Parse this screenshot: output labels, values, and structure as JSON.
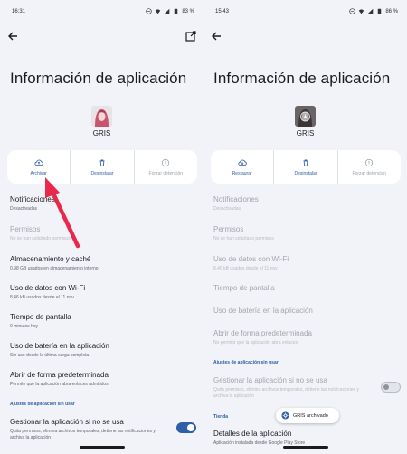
{
  "left": {
    "status": {
      "time": "16:31",
      "battery": "83 %"
    },
    "title": "Información de aplicación",
    "app_name": "GRIS",
    "actions": [
      {
        "label": "Archivar"
      },
      {
        "label": "Desinstalar"
      },
      {
        "label": "Forzar detención"
      }
    ],
    "items": {
      "notifications": {
        "title": "Notificaciones",
        "sub": "Desactivadas"
      },
      "permissions": {
        "title": "Permisos",
        "sub": "No se han solicitado permisos"
      },
      "storage": {
        "title": "Almacenamiento y caché",
        "sub": "0,98 GB usados en almacenamiento interno"
      },
      "wifi": {
        "title": "Uso de datos con Wi-Fi",
        "sub": "8,46 kB usados desde el 11 nov"
      },
      "screen_time": {
        "title": "Tiempo de pantalla",
        "sub": "0 minutos hoy"
      },
      "battery": {
        "title": "Uso de batería en la aplicación",
        "sub": "Sin uso desde la última carga completa"
      },
      "open_default": {
        "title": "Abrir de forma predeterminada",
        "sub": "Permite que la aplicación abra enlaces admitidos"
      }
    },
    "section_unused": "Ajustes de aplicación sin usar",
    "manage_unused": {
      "title": "Gestionar la aplicación si no se usa",
      "sub": "Quita permisos, elimina archivos temporales, detiene las notificaciones y archiva la aplicación",
      "enabled": true
    }
  },
  "right": {
    "status": {
      "time": "15:43",
      "battery": "86 %"
    },
    "title": "Información de aplicación",
    "app_name": "GRIS",
    "actions": [
      {
        "label": "Restaurar"
      },
      {
        "label": "Desinstalar"
      },
      {
        "label": "Forzar detención"
      }
    ],
    "items": {
      "notifications": {
        "title": "Notificaciones",
        "sub": "Desactivadas"
      },
      "permissions": {
        "title": "Permisos",
        "sub": "No se han solicitado permisos"
      },
      "wifi": {
        "title": "Uso de datos con Wi-Fi",
        "sub": "8,46 kB usados desde el 11 nov"
      },
      "screen_time": {
        "title": "Tiempo de pantalla"
      },
      "battery": {
        "title": "Uso de batería en la aplicación"
      },
      "open_default": {
        "title": "Abrir de forma predeterminada",
        "sub": "No permitir que la aplicación abra enlaces"
      }
    },
    "section_unused": "Ajustes de aplicación sin usar",
    "manage_unused": {
      "title": "Gestionar la aplicación si no se usa",
      "sub": "Quita permisos, elimina archivos temporales, detiene las notificaciones y archiva la aplicación",
      "enabled": false
    },
    "section_store": "Tienda",
    "app_details": {
      "title": "Detalles de la aplicación",
      "sub": "Aplicación instalada desde Google Play Store"
    },
    "snackbar": "GRIS archivado"
  },
  "colors": {
    "accent": "#2d5ea8",
    "background": "#f1f3f8",
    "arrow": "#e8294b"
  },
  "icons": [
    "back-arrow-icon",
    "open-external-icon",
    "cloud-upload-icon",
    "cloud-download-icon",
    "trash-icon",
    "info-icon",
    "gear-icon"
  ]
}
